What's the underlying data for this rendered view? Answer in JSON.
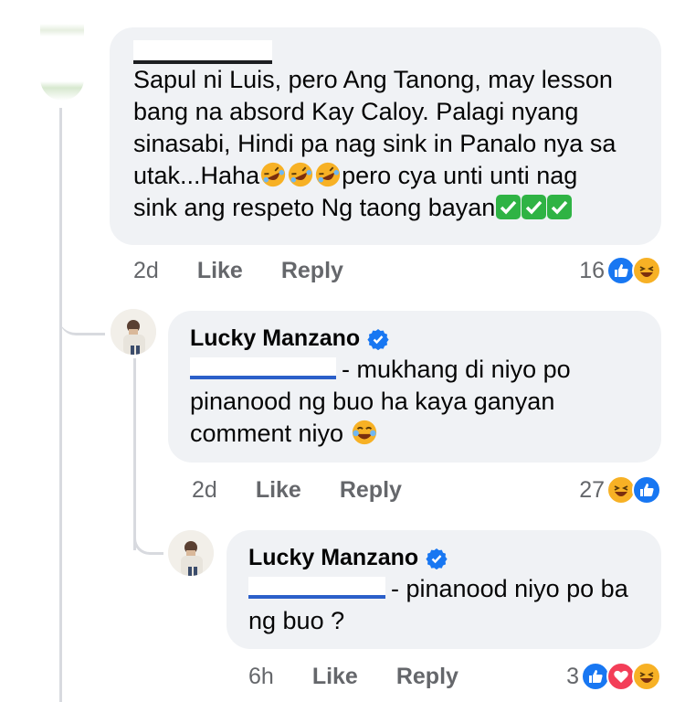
{
  "colors": {
    "bubble": "#f0f2f5",
    "meta_text": "#65676b",
    "like_blue": "#1877f2",
    "haha_yellow": "#f7b125",
    "love_red": "#f33e58",
    "check_green": "#2fb344"
  },
  "comment1": {
    "author_redacted": true,
    "lines": [
      "Sapul ni Luis, pero Ang Tanong, may lesson",
      "bang na absord Kay Caloy. Palagi nyang",
      "sinasabi, Hindi pa nag sink in Panalo nya sa"
    ],
    "line4_a": "utak...Haha",
    "line4_b": "pero cya unti unti nag",
    "line5": "sink ang respeto Ng taong bayan",
    "time": "2d",
    "like": "Like",
    "reply": "Reply",
    "reaction_count": "16",
    "reaction_icons": [
      "like-icon",
      "haha-icon"
    ]
  },
  "reply1": {
    "author": "Lucky Manzano",
    "text_line1": "- mukhang di niyo po",
    "text_line2": "pinanood ng buo ha kaya ganyan",
    "text_line3": "comment niyo",
    "time": "2d",
    "like": "Like",
    "reply": "Reply",
    "reaction_count": "27",
    "reaction_icons": [
      "haha-icon",
      "like-icon"
    ]
  },
  "reply2": {
    "author": "Lucky Manzano",
    "text_line1": "- pinanood niyo po ba",
    "text_line2": "ng buo ?",
    "time": "6h",
    "like": "Like",
    "reply": "Reply",
    "reaction_count": "3",
    "reaction_icons": [
      "like-icon",
      "love-icon",
      "haha-icon"
    ]
  }
}
